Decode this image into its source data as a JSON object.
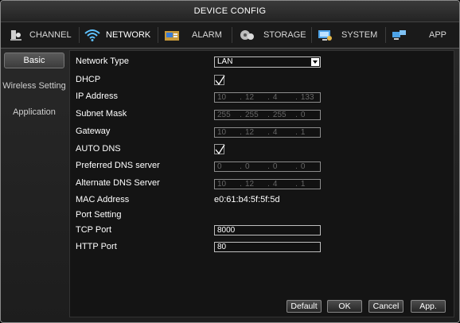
{
  "window": {
    "title": "DEVICE CONFIG"
  },
  "tabs": [
    {
      "label": "CHANNEL",
      "icon": "channel-icon"
    },
    {
      "label": "NETWORK",
      "icon": "wifi-icon",
      "active": true
    },
    {
      "label": "ALARM",
      "icon": "alarm-icon"
    },
    {
      "label": "STORAGE",
      "icon": "storage-icon"
    },
    {
      "label": "SYSTEM",
      "icon": "system-icon"
    },
    {
      "label": "APP",
      "icon": "app-icon"
    }
  ],
  "sidebar": {
    "items": [
      {
        "label": "Basic",
        "active": true
      },
      {
        "label": "Wireless Setting"
      },
      {
        "label": "Application"
      }
    ]
  },
  "form": {
    "network_type": {
      "label": "Network Type",
      "value": "LAN"
    },
    "dhcp": {
      "label": "DHCP",
      "checked": true
    },
    "ip_address": {
      "label": "IP Address",
      "octets": [
        "10",
        "12",
        "4",
        "133"
      ]
    },
    "subnet_mask": {
      "label": "Subnet Mask",
      "octets": [
        "255",
        "255",
        "255",
        "0"
      ]
    },
    "gateway": {
      "label": "Gateway",
      "octets": [
        "10",
        "12",
        "4",
        "1"
      ]
    },
    "auto_dns": {
      "label": "AUTO DNS",
      "checked": true
    },
    "preferred_dns": {
      "label": "Preferred DNS server",
      "octets": [
        "0",
        "0",
        "0",
        "0"
      ]
    },
    "alternate_dns": {
      "label": "Alternate DNS Server",
      "octets": [
        "10",
        "12",
        "4",
        "1"
      ]
    },
    "mac_address": {
      "label": "MAC Address",
      "value": "e0:61:b4:5f:5f:5d"
    },
    "port_setting": {
      "label": "Port Setting"
    },
    "tcp_port": {
      "label": "TCP Port",
      "value": "8000"
    },
    "http_port": {
      "label": "HTTP Port",
      "value": "80"
    }
  },
  "buttons": {
    "default": "Default",
    "ok": "OK",
    "cancel": "Cancel",
    "apply": "App."
  }
}
